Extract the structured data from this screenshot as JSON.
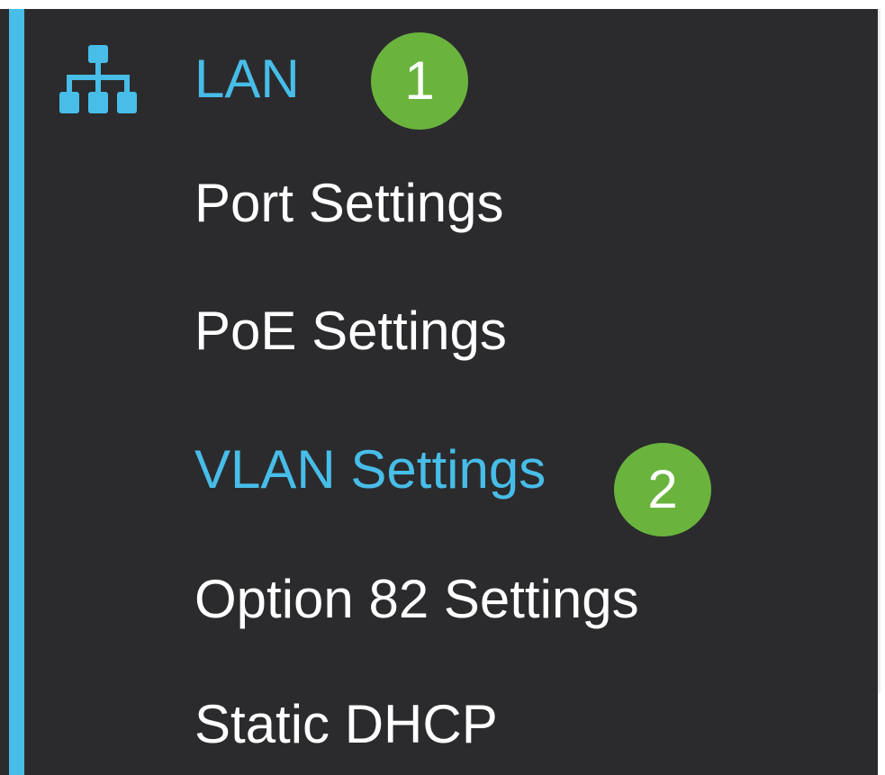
{
  "colors": {
    "panel_background": "#2b2b2d",
    "accent": "#47bde8",
    "active_text": "#47bde8",
    "item_text": "#ffffff",
    "badge": "#6ab43e"
  },
  "menu": {
    "section": {
      "icon": "network-topology-icon",
      "label": "LAN",
      "step_badge": "1"
    },
    "items": [
      {
        "label": "Port Settings",
        "active": false
      },
      {
        "label": "PoE Settings",
        "active": false
      },
      {
        "label": "VLAN Settings",
        "active": true,
        "step_badge": "2"
      },
      {
        "label": "Option 82 Settings",
        "active": false
      },
      {
        "label": "Static DHCP",
        "active": false
      }
    ]
  }
}
